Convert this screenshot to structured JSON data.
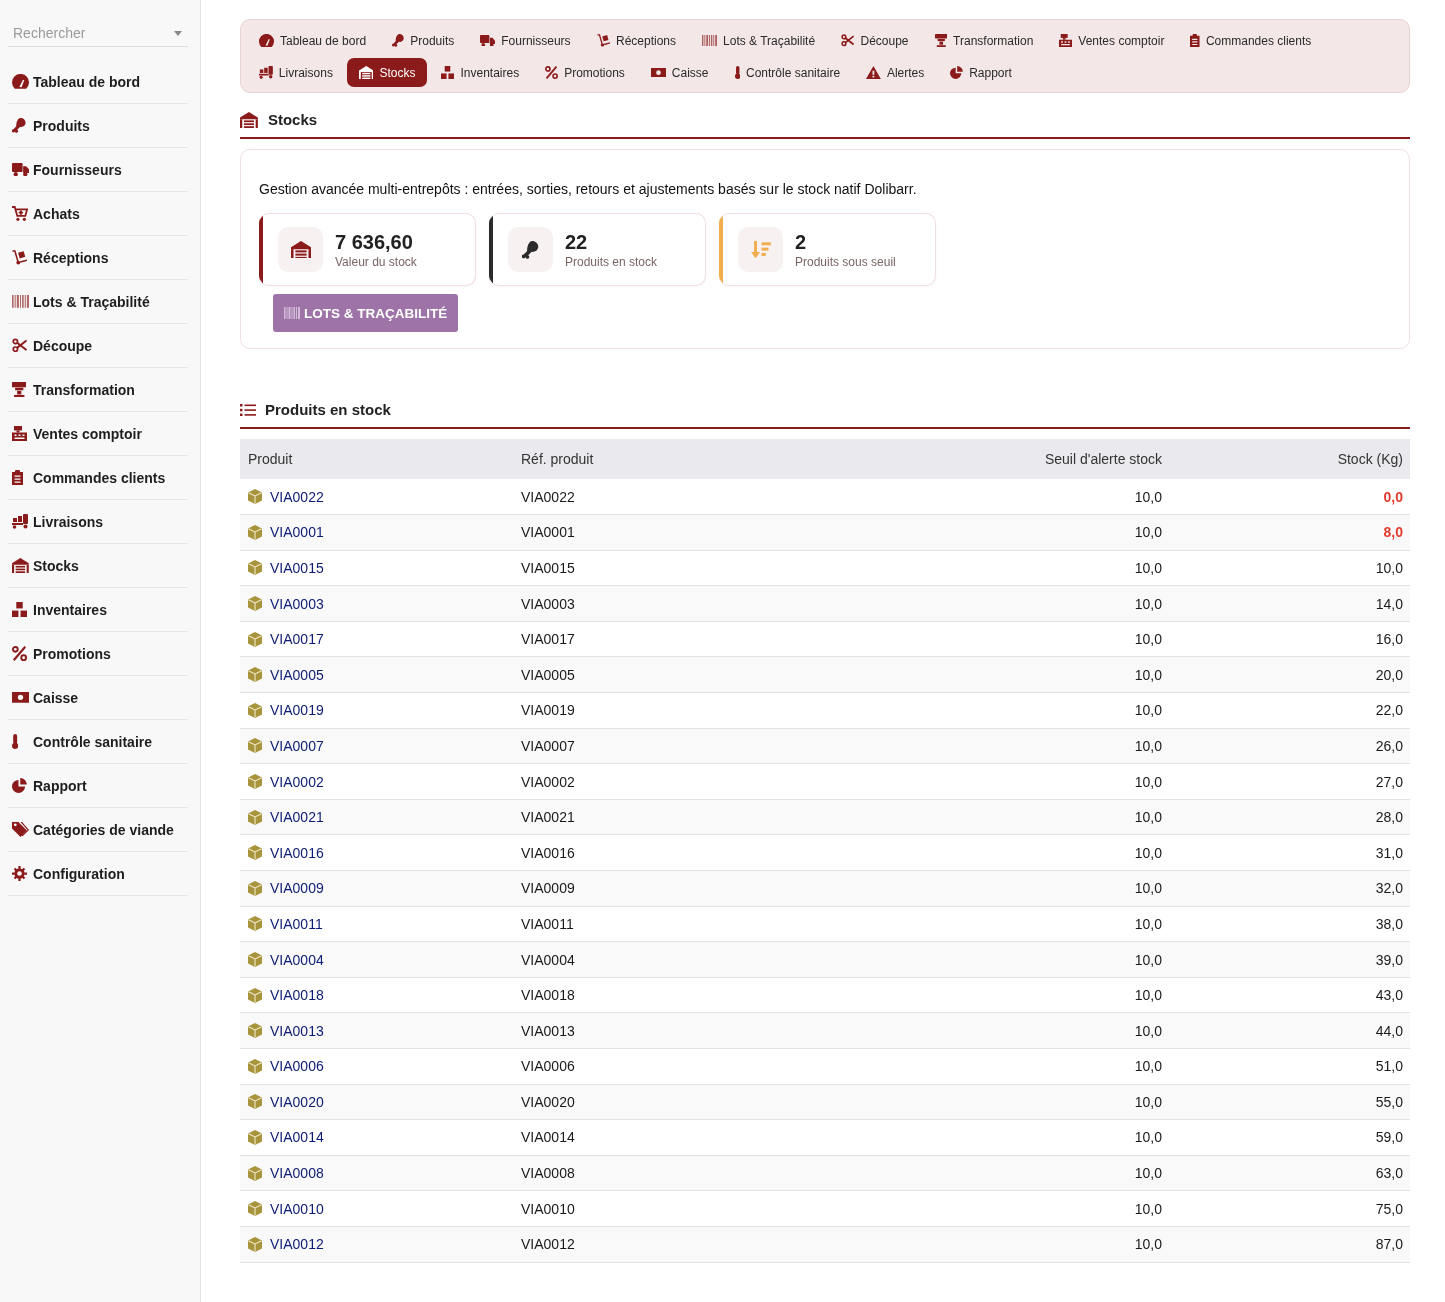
{
  "sidebar": {
    "search": {
      "placeholder": "Rechercher"
    },
    "items": [
      {
        "label": "Tableau de bord",
        "selected": false
      },
      {
        "label": "Produits",
        "selected": false
      },
      {
        "label": "Fournisseurs",
        "selected": false
      },
      {
        "label": "Achats",
        "selected": false
      },
      {
        "label": "Réceptions",
        "selected": false
      },
      {
        "label": "Lots & Traçabilité",
        "selected": false
      },
      {
        "label": "Découpe",
        "selected": false
      },
      {
        "label": "Transformation",
        "selected": false
      },
      {
        "label": "Ventes comptoir",
        "selected": false
      },
      {
        "label": "Commandes clients",
        "selected": false
      },
      {
        "label": "Livraisons",
        "selected": false
      },
      {
        "label": "Stocks",
        "selected": false
      },
      {
        "label": "Inventaires",
        "selected": false
      },
      {
        "label": "Promotions",
        "selected": false
      },
      {
        "label": "Caisse",
        "selected": false
      },
      {
        "label": "Contrôle sanitaire",
        "selected": false
      },
      {
        "label": "Rapport",
        "selected": false
      },
      {
        "label": "Catégories de viande",
        "selected": false
      },
      {
        "label": "Configuration",
        "selected": false
      }
    ]
  },
  "nav": {
    "tabs": [
      {
        "label": "Tableau de bord",
        "selected": false
      },
      {
        "label": "Produits",
        "selected": false
      },
      {
        "label": "Fournisseurs",
        "selected": false
      },
      {
        "label": "Réceptions",
        "selected": false
      },
      {
        "label": "Lots & Traçabilité",
        "selected": false
      },
      {
        "label": "Découpe",
        "selected": false
      },
      {
        "label": "Transformation",
        "selected": false
      },
      {
        "label": "Ventes comptoir",
        "selected": false
      },
      {
        "label": "Commandes clients",
        "selected": false
      },
      {
        "label": "Livraisons",
        "selected": false
      },
      {
        "label": "Stocks",
        "selected": true
      },
      {
        "label": "Inventaires",
        "selected": false
      },
      {
        "label": "Promotions",
        "selected": false
      },
      {
        "label": "Caisse",
        "selected": false
      },
      {
        "label": "Contrôle sanitaire",
        "selected": false
      },
      {
        "label": "Alertes",
        "selected": false
      },
      {
        "label": "Rapport",
        "selected": false
      }
    ]
  },
  "page": {
    "title": "Stocks",
    "description": "Gestion avancée multi-entrepôts : entrées, sorties, retours et ajustements basés sur le stock natif Dolibarr.",
    "stats": [
      {
        "value": "7 636,60",
        "label": "Valeur du stock",
        "color": "#8b1a1a"
      },
      {
        "value": "22",
        "label": "Produits en stock",
        "color": "#2b2b2b"
      },
      {
        "value": "2",
        "label": "Produits sous seuil",
        "color": "#f0ad4e"
      }
    ],
    "button": {
      "label": "LOTS & TRAÇABILITÉ"
    }
  },
  "products": {
    "title": "Produits en stock",
    "table": {
      "columns": [
        "Produit",
        "Réf. produit",
        "Seuil d'alerte stock",
        "Stock (Kg)"
      ],
      "rows": [
        {
          "product": "VIA0022",
          "ref": "VIA0022",
          "threshold": "10,0",
          "stock": "0,0",
          "below_threshold": true
        },
        {
          "product": "VIA0001",
          "ref": "VIA0001",
          "threshold": "10,0",
          "stock": "8,0",
          "below_threshold": true
        },
        {
          "product": "VIA0015",
          "ref": "VIA0015",
          "threshold": "10,0",
          "stock": "10,0",
          "below_threshold": false
        },
        {
          "product": "VIA0003",
          "ref": "VIA0003",
          "threshold": "10,0",
          "stock": "14,0",
          "below_threshold": false
        },
        {
          "product": "VIA0017",
          "ref": "VIA0017",
          "threshold": "10,0",
          "stock": "16,0",
          "below_threshold": false
        },
        {
          "product": "VIA0005",
          "ref": "VIA0005",
          "threshold": "10,0",
          "stock": "20,0",
          "below_threshold": false
        },
        {
          "product": "VIA0019",
          "ref": "VIA0019",
          "threshold": "10,0",
          "stock": "22,0",
          "below_threshold": false
        },
        {
          "product": "VIA0007",
          "ref": "VIA0007",
          "threshold": "10,0",
          "stock": "26,0",
          "below_threshold": false
        },
        {
          "product": "VIA0002",
          "ref": "VIA0002",
          "threshold": "10,0",
          "stock": "27,0",
          "below_threshold": false
        },
        {
          "product": "VIA0021",
          "ref": "VIA0021",
          "threshold": "10,0",
          "stock": "28,0",
          "below_threshold": false
        },
        {
          "product": "VIA0016",
          "ref": "VIA0016",
          "threshold": "10,0",
          "stock": "31,0",
          "below_threshold": false
        },
        {
          "product": "VIA0009",
          "ref": "VIA0009",
          "threshold": "10,0",
          "stock": "32,0",
          "below_threshold": false
        },
        {
          "product": "VIA0011",
          "ref": "VIA0011",
          "threshold": "10,0",
          "stock": "38,0",
          "below_threshold": false
        },
        {
          "product": "VIA0004",
          "ref": "VIA0004",
          "threshold": "10,0",
          "stock": "39,0",
          "below_threshold": false
        },
        {
          "product": "VIA0018",
          "ref": "VIA0018",
          "threshold": "10,0",
          "stock": "43,0",
          "below_threshold": false
        },
        {
          "product": "VIA0013",
          "ref": "VIA0013",
          "threshold": "10,0",
          "stock": "44,0",
          "below_threshold": false
        },
        {
          "product": "VIA0006",
          "ref": "VIA0006",
          "threshold": "10,0",
          "stock": "51,0",
          "below_threshold": false
        },
        {
          "product": "VIA0020",
          "ref": "VIA0020",
          "threshold": "10,0",
          "stock": "55,0",
          "below_threshold": false
        },
        {
          "product": "VIA0014",
          "ref": "VIA0014",
          "threshold": "10,0",
          "stock": "59,0",
          "below_threshold": false
        },
        {
          "product": "VIA0008",
          "ref": "VIA0008",
          "threshold": "10,0",
          "stock": "63,0",
          "below_threshold": false
        },
        {
          "product": "VIA0010",
          "ref": "VIA0010",
          "threshold": "10,0",
          "stock": "75,0",
          "below_threshold": false
        },
        {
          "product": "VIA0012",
          "ref": "VIA0012",
          "threshold": "10,0",
          "stock": "87,0",
          "below_threshold": false
        }
      ]
    }
  }
}
